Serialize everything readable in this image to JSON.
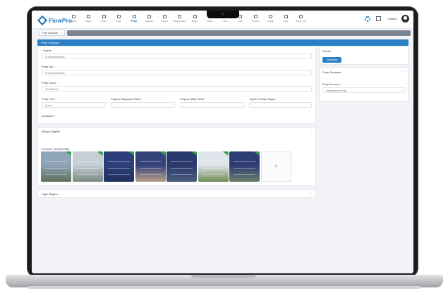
{
  "brand": {
    "name": "FlowPro",
    "color": "#1a73b8"
  },
  "nav": {
    "items": [
      {
        "label": "Listele",
        "icon": "list-icon"
      },
      {
        "label": "Görev",
        "icon": "task-icon"
      },
      {
        "label": "Proje",
        "icon": "folder-icon"
      },
      {
        "label": "Proje",
        "icon": "folder-icon"
      },
      {
        "label": "Proje",
        "icon": "project-icon",
        "active": true
      },
      {
        "label": "Kategori",
        "icon": "tag-icon"
      },
      {
        "label": "Kaydet",
        "icon": "save-icon"
      },
      {
        "label": "Belge Oluştur",
        "icon": "document-icon"
      },
      {
        "label": "Rapor",
        "icon": "chart-icon"
      },
      {
        "label": "Takvim",
        "icon": "calendar-icon"
      },
      {
        "label": "Yetki",
        "icon": "lock-icon"
      },
      {
        "label": "Liste",
        "icon": "list-icon"
      },
      {
        "label": "Yönetim",
        "icon": "admin-icon"
      },
      {
        "label": "Ayarlar",
        "icon": "settings-icon"
      },
      {
        "label": "Çıkış",
        "icon": "exit-icon"
      },
      {
        "label": "Dosya Yük.",
        "icon": "upload-icon"
      }
    ]
  },
  "user": {
    "name": "Kullanıcı"
  },
  "tabs": [
    {
      "label": "Proje Detayları"
    }
  ],
  "page_title": "Proje Detayları",
  "form": {
    "fields": [
      {
        "label": "Başlık",
        "required": true,
        "value": "Cumhuriyet Sitesi"
      },
      {
        "label": "Proje Adı",
        "required": true,
        "value": "Cumhuriyet Sitesi"
      },
      {
        "label": "Proje Kodu",
        "required": true,
        "value": "CM-2023-04"
      }
    ],
    "row4": [
      {
        "label": "Proje Türü",
        "required": true,
        "value": "Konut"
      },
      {
        "label": "Projenin Başlama Tarihi",
        "required": true,
        "value": "-"
      },
      {
        "label": "Projenin Bitiş Tarihi",
        "required": true,
        "value": "-"
      },
      {
        "label": "Toplam Emlak Sayısı",
        "required": true,
        "value": "-"
      }
    ],
    "description_label": "Açıklama"
  },
  "status_card": {
    "title": "Durum",
    "button": "Güncelle"
  },
  "details_card": {
    "title": "Proje Detayları",
    "status_label": "Proje Durumu",
    "status_value": "Tamamlanan Proje"
  },
  "media_section": {
    "title": "Medya Bilgileri",
    "photos_label": "Resimler (1920x1080)",
    "add_label": "+"
  },
  "other_section": {
    "title": "Diğer Bilgileri"
  },
  "photos": [
    {
      "name": "photo-1",
      "c1": "#8fa4b8",
      "c2": "#5f6f5a"
    },
    {
      "name": "photo-2",
      "c1": "#c6ced6",
      "c2": "#7a8a80"
    },
    {
      "name": "photo-3",
      "c1": "#2d3f7a",
      "c2": "#20305e"
    },
    {
      "name": "photo-4",
      "c1": "#34427a",
      "c2": "#b8a08a"
    },
    {
      "name": "photo-5",
      "c1": "#2a3a6e",
      "c2": "#4a5c7a"
    },
    {
      "name": "photo-6",
      "c1": "#dfe5ea",
      "c2": "#6f8a55"
    },
    {
      "name": "photo-7",
      "c1": "#2d3c73",
      "c2": "#6a7f6b"
    }
  ]
}
